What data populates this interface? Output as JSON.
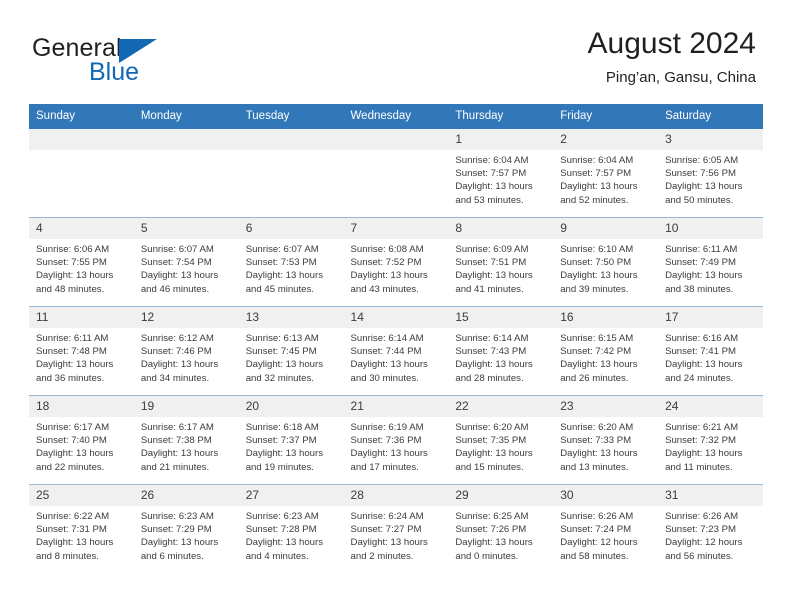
{
  "brand": {
    "word_one": "General",
    "word_two": "Blue",
    "accent_color": "#1268b3"
  },
  "header": {
    "title": "August 2024",
    "subtitle": "Ping’an, Gansu, China"
  },
  "theme": {
    "header_row_bg": "#3277b8",
    "header_row_text": "#ffffff",
    "daynum_bg": "#f0f0f0",
    "grid_line": "#96b7d8"
  },
  "weekdays": [
    "Sunday",
    "Monday",
    "Tuesday",
    "Wednesday",
    "Thursday",
    "Friday",
    "Saturday"
  ],
  "weeks": [
    [
      {
        "day": "",
        "empty": true
      },
      {
        "day": "",
        "empty": true
      },
      {
        "day": "",
        "empty": true
      },
      {
        "day": "",
        "empty": true
      },
      {
        "day": "1",
        "sunrise": "Sunrise: 6:04 AM",
        "sunset": "Sunset: 7:57 PM",
        "daylight1": "Daylight: 13 hours",
        "daylight2": "and 53 minutes."
      },
      {
        "day": "2",
        "sunrise": "Sunrise: 6:04 AM",
        "sunset": "Sunset: 7:57 PM",
        "daylight1": "Daylight: 13 hours",
        "daylight2": "and 52 minutes."
      },
      {
        "day": "3",
        "sunrise": "Sunrise: 6:05 AM",
        "sunset": "Sunset: 7:56 PM",
        "daylight1": "Daylight: 13 hours",
        "daylight2": "and 50 minutes."
      }
    ],
    [
      {
        "day": "4",
        "sunrise": "Sunrise: 6:06 AM",
        "sunset": "Sunset: 7:55 PM",
        "daylight1": "Daylight: 13 hours",
        "daylight2": "and 48 minutes."
      },
      {
        "day": "5",
        "sunrise": "Sunrise: 6:07 AM",
        "sunset": "Sunset: 7:54 PM",
        "daylight1": "Daylight: 13 hours",
        "daylight2": "and 46 minutes."
      },
      {
        "day": "6",
        "sunrise": "Sunrise: 6:07 AM",
        "sunset": "Sunset: 7:53 PM",
        "daylight1": "Daylight: 13 hours",
        "daylight2": "and 45 minutes."
      },
      {
        "day": "7",
        "sunrise": "Sunrise: 6:08 AM",
        "sunset": "Sunset: 7:52 PM",
        "daylight1": "Daylight: 13 hours",
        "daylight2": "and 43 minutes."
      },
      {
        "day": "8",
        "sunrise": "Sunrise: 6:09 AM",
        "sunset": "Sunset: 7:51 PM",
        "daylight1": "Daylight: 13 hours",
        "daylight2": "and 41 minutes."
      },
      {
        "day": "9",
        "sunrise": "Sunrise: 6:10 AM",
        "sunset": "Sunset: 7:50 PM",
        "daylight1": "Daylight: 13 hours",
        "daylight2": "and 39 minutes."
      },
      {
        "day": "10",
        "sunrise": "Sunrise: 6:11 AM",
        "sunset": "Sunset: 7:49 PM",
        "daylight1": "Daylight: 13 hours",
        "daylight2": "and 38 minutes."
      }
    ],
    [
      {
        "day": "11",
        "sunrise": "Sunrise: 6:11 AM",
        "sunset": "Sunset: 7:48 PM",
        "daylight1": "Daylight: 13 hours",
        "daylight2": "and 36 minutes."
      },
      {
        "day": "12",
        "sunrise": "Sunrise: 6:12 AM",
        "sunset": "Sunset: 7:46 PM",
        "daylight1": "Daylight: 13 hours",
        "daylight2": "and 34 minutes."
      },
      {
        "day": "13",
        "sunrise": "Sunrise: 6:13 AM",
        "sunset": "Sunset: 7:45 PM",
        "daylight1": "Daylight: 13 hours",
        "daylight2": "and 32 minutes."
      },
      {
        "day": "14",
        "sunrise": "Sunrise: 6:14 AM",
        "sunset": "Sunset: 7:44 PM",
        "daylight1": "Daylight: 13 hours",
        "daylight2": "and 30 minutes."
      },
      {
        "day": "15",
        "sunrise": "Sunrise: 6:14 AM",
        "sunset": "Sunset: 7:43 PM",
        "daylight1": "Daylight: 13 hours",
        "daylight2": "and 28 minutes."
      },
      {
        "day": "16",
        "sunrise": "Sunrise: 6:15 AM",
        "sunset": "Sunset: 7:42 PM",
        "daylight1": "Daylight: 13 hours",
        "daylight2": "and 26 minutes."
      },
      {
        "day": "17",
        "sunrise": "Sunrise: 6:16 AM",
        "sunset": "Sunset: 7:41 PM",
        "daylight1": "Daylight: 13 hours",
        "daylight2": "and 24 minutes."
      }
    ],
    [
      {
        "day": "18",
        "sunrise": "Sunrise: 6:17 AM",
        "sunset": "Sunset: 7:40 PM",
        "daylight1": "Daylight: 13 hours",
        "daylight2": "and 22 minutes."
      },
      {
        "day": "19",
        "sunrise": "Sunrise: 6:17 AM",
        "sunset": "Sunset: 7:38 PM",
        "daylight1": "Daylight: 13 hours",
        "daylight2": "and 21 minutes."
      },
      {
        "day": "20",
        "sunrise": "Sunrise: 6:18 AM",
        "sunset": "Sunset: 7:37 PM",
        "daylight1": "Daylight: 13 hours",
        "daylight2": "and 19 minutes."
      },
      {
        "day": "21",
        "sunrise": "Sunrise: 6:19 AM",
        "sunset": "Sunset: 7:36 PM",
        "daylight1": "Daylight: 13 hours",
        "daylight2": "and 17 minutes."
      },
      {
        "day": "22",
        "sunrise": "Sunrise: 6:20 AM",
        "sunset": "Sunset: 7:35 PM",
        "daylight1": "Daylight: 13 hours",
        "daylight2": "and 15 minutes."
      },
      {
        "day": "23",
        "sunrise": "Sunrise: 6:20 AM",
        "sunset": "Sunset: 7:33 PM",
        "daylight1": "Daylight: 13 hours",
        "daylight2": "and 13 minutes."
      },
      {
        "day": "24",
        "sunrise": "Sunrise: 6:21 AM",
        "sunset": "Sunset: 7:32 PM",
        "daylight1": "Daylight: 13 hours",
        "daylight2": "and 11 minutes."
      }
    ],
    [
      {
        "day": "25",
        "sunrise": "Sunrise: 6:22 AM",
        "sunset": "Sunset: 7:31 PM",
        "daylight1": "Daylight: 13 hours",
        "daylight2": "and 8 minutes."
      },
      {
        "day": "26",
        "sunrise": "Sunrise: 6:23 AM",
        "sunset": "Sunset: 7:29 PM",
        "daylight1": "Daylight: 13 hours",
        "daylight2": "and 6 minutes."
      },
      {
        "day": "27",
        "sunrise": "Sunrise: 6:23 AM",
        "sunset": "Sunset: 7:28 PM",
        "daylight1": "Daylight: 13 hours",
        "daylight2": "and 4 minutes."
      },
      {
        "day": "28",
        "sunrise": "Sunrise: 6:24 AM",
        "sunset": "Sunset: 7:27 PM",
        "daylight1": "Daylight: 13 hours",
        "daylight2": "and 2 minutes."
      },
      {
        "day": "29",
        "sunrise": "Sunrise: 6:25 AM",
        "sunset": "Sunset: 7:26 PM",
        "daylight1": "Daylight: 13 hours",
        "daylight2": "and 0 minutes."
      },
      {
        "day": "30",
        "sunrise": "Sunrise: 6:26 AM",
        "sunset": "Sunset: 7:24 PM",
        "daylight1": "Daylight: 12 hours",
        "daylight2": "and 58 minutes."
      },
      {
        "day": "31",
        "sunrise": "Sunrise: 6:26 AM",
        "sunset": "Sunset: 7:23 PM",
        "daylight1": "Daylight: 12 hours",
        "daylight2": "and 56 minutes."
      }
    ]
  ]
}
